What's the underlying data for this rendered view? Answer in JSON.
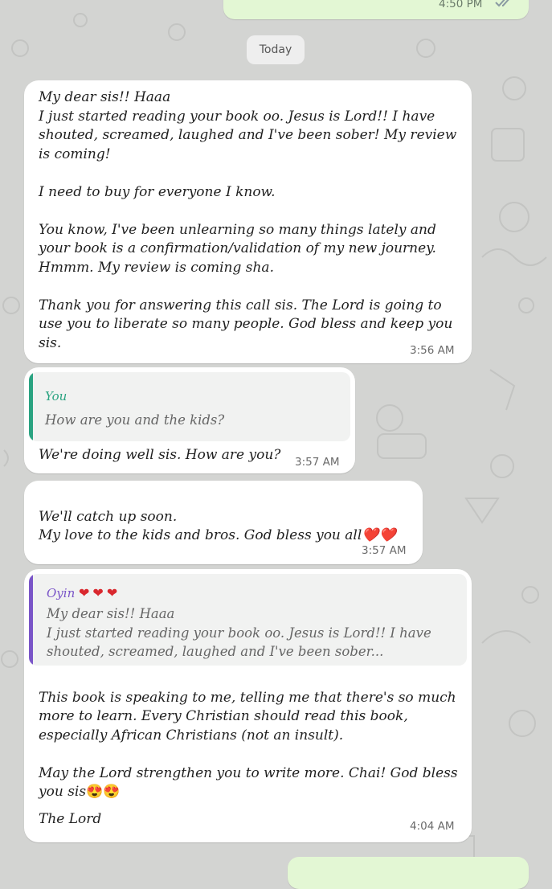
{
  "colors": {
    "background": "#d3d4d2",
    "incoming_bubble": "#ffffff",
    "outgoing_bubble": "#e3f7d4",
    "reply_you": "#2aa381",
    "reply_oyin": "#7a55c8",
    "read_ticks": "#8a9aa2"
  },
  "top_outgoing": {
    "time": "4:50 PM",
    "ticks": "read-double-check-icon"
  },
  "date_chip": "Today",
  "messages": [
    {
      "text": "My dear sis!! Haaa\nI just started reading your book oo. Jesus is Lord!!  I have shouted, screamed, laughed and I've been sober! My review is coming!\n\nI need to buy for everyone I know.\n\nYou know, I've been unlearning so many things lately and your book is a confirmation/validation of my new journey. Hmmm. My review is coming sha.\n\nThank you for answering this call sis. The Lord is going to use you to liberate so many people. God bless and keep you sis.",
      "time": "3:56 AM"
    },
    {
      "reply": {
        "author": "You",
        "text": "How are you and the kids?"
      },
      "text": "We're doing well sis. How are you?",
      "time": "3:57 AM"
    },
    {
      "text": "We'll catch up soon.\nMy love to the kids and bros. God bless you all",
      "emoji": "❤️❤️",
      "time": "3:57 AM"
    },
    {
      "reply": {
        "author": "Oyin",
        "author_emoji": "❤❤❤",
        "text": "My dear sis!! Haaa\nI just started reading your book oo. Jesus is Lord!!  I have shouted, screamed, laughed and I've been sober..."
      },
      "text": "This book is speaking to me, telling me that there's so much more to learn. Every Christian should read this book, especially African Christians (not an insult).\n\nMay the Lord strengthen you to write more. Chai! God bless you sis",
      "emoji": "😍😍",
      "text2": "The Lord",
      "time": "4:04 AM"
    }
  ]
}
